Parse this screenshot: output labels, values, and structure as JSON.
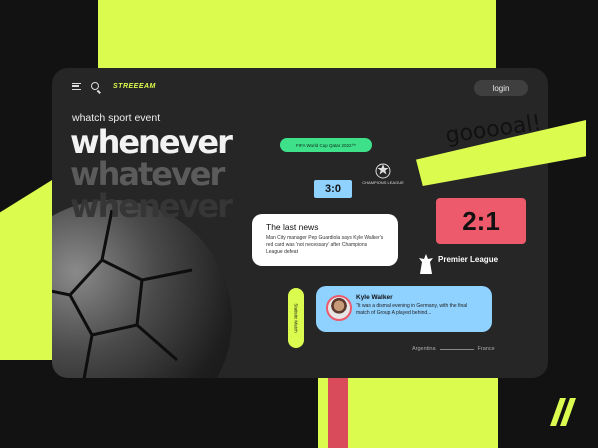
{
  "brand": "STREEEAM",
  "login_label": "login",
  "subtitle": "whatch sport event",
  "hero": [
    "whenever",
    "whatever",
    "whenever"
  ],
  "world_cup_label": "FIFA World Cup Qatar 2022™",
  "score_small": "3:0",
  "champions_label": "CHAMPIONS LEAGUE",
  "news": {
    "title": "The last news",
    "text": "Man City manager Pep Guardiola says Kyle Walker's red card was 'not necessary' after Champions League defeat"
  },
  "score_big": "2:1",
  "premier_league": "Premier League",
  "stat_label": "Statistic Match",
  "comment": {
    "name": "Kyle Walker",
    "text": "\"It was a dismal evening in Germany, with the final match of Group A played behind..."
  },
  "match": {
    "home": "Argentina",
    "away": "France"
  },
  "goal_text": "gooooal!",
  "colors": {
    "accent_lime": "#dcfb4f",
    "accent_red": "#ec5a6c",
    "accent_blue": "#8fd1ff",
    "accent_green": "#3fe08a"
  },
  "icons": [
    "menu-icon",
    "search-icon",
    "champions-league-icon",
    "premier-league-icon",
    "avatar",
    "slashes-logo"
  ]
}
